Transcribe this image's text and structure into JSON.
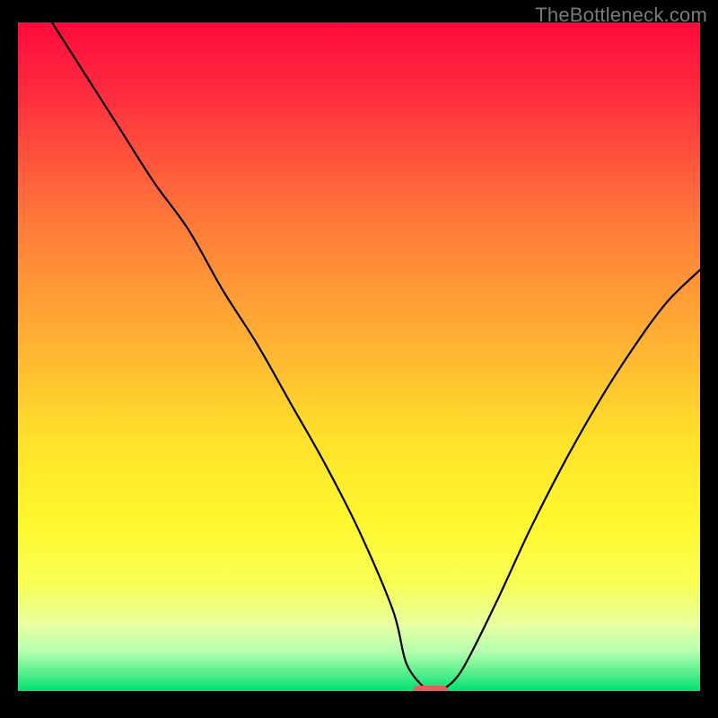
{
  "watermark": "TheBottleneck.com",
  "chart_data": {
    "type": "line",
    "title": "",
    "xlabel": "",
    "ylabel": "",
    "xlim": [
      0,
      100
    ],
    "ylim": [
      0,
      100
    ],
    "x": [
      5,
      10,
      15,
      20,
      25,
      30,
      35,
      40,
      45,
      50,
      55,
      57,
      60,
      62,
      65,
      70,
      75,
      80,
      85,
      90,
      95,
      100
    ],
    "values": [
      100,
      92,
      84,
      76,
      69,
      60,
      52,
      43,
      34,
      24,
      12,
      4,
      0,
      0,
      3,
      13,
      24,
      34,
      43,
      51,
      58,
      63
    ],
    "trough": {
      "x_start": 58,
      "x_end": 63,
      "y": 0
    },
    "marker_color": "#e06060",
    "line_color": "#000000"
  }
}
